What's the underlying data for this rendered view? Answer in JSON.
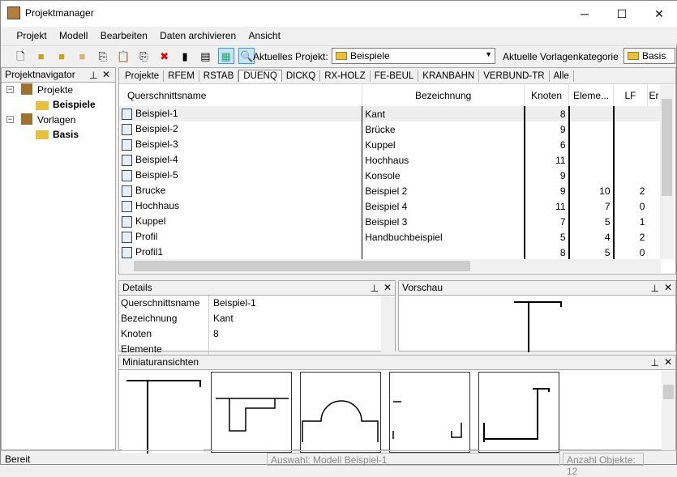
{
  "window": {
    "title": "Projektmanager",
    "minimize": "─",
    "maximize": "☐",
    "close": "✕"
  },
  "menu": [
    "Projekt",
    "Modell",
    "Bearbeiten",
    "Daten archivieren",
    "Ansicht"
  ],
  "toolbar": {
    "project_label": "Aktuelles Projekt:",
    "project_value": "Beispiele",
    "template_label": "Aktuelle Vorlagenkategorie",
    "template_value": "Basis"
  },
  "navigator": {
    "title": "Projektnavigator",
    "items": [
      "Projekte",
      "Beispiele",
      "Vorlagen",
      "Basis"
    ]
  },
  "tabs": [
    "Projekte",
    "RFEM",
    "RSTAB",
    "DUENQ",
    "DICKQ",
    "RX-HOLZ",
    "FE-BEUL",
    "KRANBAHN",
    "VERBUND-TR",
    "Alle"
  ],
  "active_tab": "DUENQ",
  "table": {
    "columns": [
      "Querschnittsname",
      "Bezeichnung",
      "Knoten",
      "Eleme...",
      "LF",
      "Er"
    ],
    "rows": [
      [
        "Beispiel-1",
        "Kant",
        "8",
        "",
        "",
        ""
      ],
      [
        "Beispiel-2",
        "Brücke",
        "9",
        "",
        "",
        ""
      ],
      [
        "Beispiel-3",
        "Kuppel",
        "6",
        "",
        "",
        ""
      ],
      [
        "Beispiel-4",
        "Hochhaus",
        "11",
        "",
        "",
        ""
      ],
      [
        "Beispiel-5",
        "Konsole",
        "9",
        "",
        "",
        ""
      ],
      [
        "Brucke",
        "Beispiel 2",
        "9",
        "10",
        "2",
        ""
      ],
      [
        "Hochhaus",
        "Beispiel 4",
        "11",
        "7",
        "0",
        ""
      ],
      [
        "Kuppel",
        "Beispiel 3",
        "7",
        "5",
        "1",
        ""
      ],
      [
        "Profil",
        "Handbuchbeispiel",
        "5",
        "4",
        "2",
        ""
      ],
      [
        "Profil1",
        "",
        "8",
        "5",
        "0",
        ""
      ]
    ]
  },
  "details": {
    "title": "Details",
    "rows": [
      [
        "Querschnittsname",
        "Beispiel-1"
      ],
      [
        "Bezeichnung",
        "Kant"
      ],
      [
        "Knoten",
        "8"
      ],
      [
        "Elemente",
        ""
      ]
    ]
  },
  "preview": {
    "title": "Vorschau"
  },
  "miniatures": {
    "title": "Miniaturansichten"
  },
  "status": {
    "left": "Bereit",
    "selection": "Auswahl: Modell Beispiel-1",
    "count": "Anzahl Objekte: 12"
  }
}
